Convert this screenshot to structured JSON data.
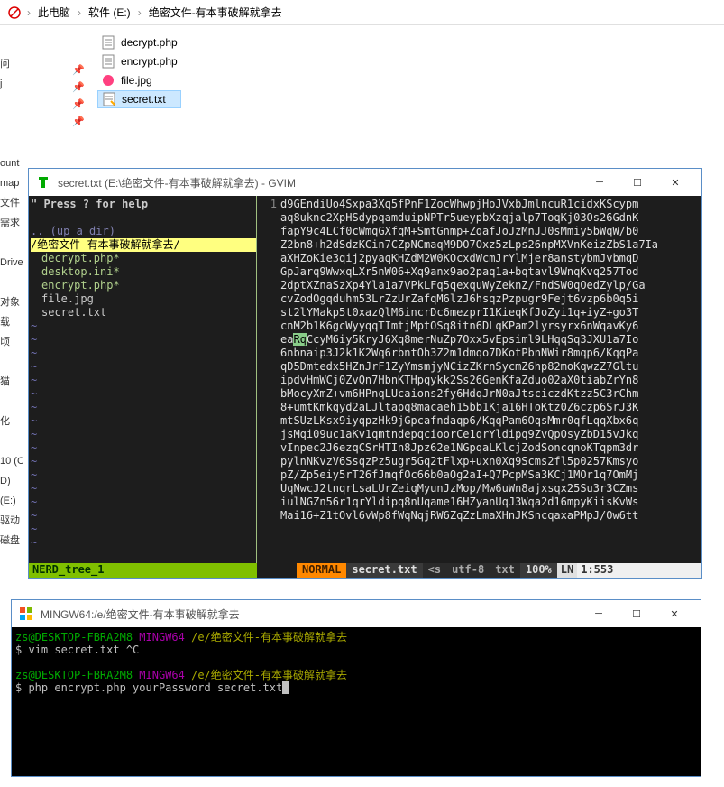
{
  "explorer": {
    "breadcrumb": {
      "root": "此电脑",
      "drive": "软件 (E:)",
      "folder": "绝密文件-有本事破解就拿去"
    },
    "files": [
      {
        "name": "decrypt.php",
        "icon": "php"
      },
      {
        "name": "encrypt.php",
        "icon": "php"
      },
      {
        "name": "file.jpg",
        "icon": "image"
      },
      {
        "name": "secret.txt",
        "icon": "text",
        "selected": true
      }
    ]
  },
  "left_fragments": [
    "问",
    "j",
    "",
    "",
    "",
    "ount",
    "map",
    "文件",
    "需求",
    "",
    "Drive",
    "",
    "对象",
    "载",
    "顷",
    "",
    "猫",
    "",
    "化",
    "",
    "10 (C",
    "D)",
    " (E:)",
    "驱动",
    "磁盘"
  ],
  "gvim": {
    "title": "secret.txt (E:\\绝密文件-有本事破解就拿去) - GVIM",
    "help": "\"  Press ? for help",
    "updir": ".. (up a dir)",
    "dir": "/绝密文件-有本事破解就拿去/",
    "tree_files": [
      "decrypt.php",
      "desktop.ini",
      "encrypt.php",
      "file.jpg",
      "secret.txt"
    ],
    "content_lines": [
      "d9GEndiUo4Sxpa3Xq5fPnF1ZocWhwpjHoJVxbJmlncuR1cidxKScypm",
      "aq8uknc2XpHSdypqamduipNPTr5ueypbXzqjalp7ToqKj03Os26GdnK",
      "fapY9c4LCf0cWmqGXfqM+SmtGnmp+ZqafJoJzMnJJ0sMmiy5bWqW/b0",
      "Z2bn8+h2dSdzKCin7CZpNCmaqM9DO7Oxz5zLps26npMXVnKeizZbS1a7Ia",
      "aXHZoKie3qij2pyaqKHZdM2W0KOcxdWcmJrYlMjer8anstybmJvbmqD",
      "GpJarq9WwxqLXr5nW06+Xq9anx9ao2paq1a+bqtavl9WnqKvq257Tod",
      "2dptXZnaSzXp4Yla1a7VPkLFq5qexquWyZeknZ/FndSW0qOedZylp/Ga",
      "cvZodOgqduhm53LrZzUrZafqM6lzJ6hsqzPzpugr9Fejt6vzp6b0q5i",
      "st2lYMakp5t0xazQlM6incrDc6mezprI1KieqKfJoZyi1q+iyZ+go3T",
      "cnM2b1K6gcWyyqqTImtjMptOSq8itn6DLqKPam2lyrsyrx6nWqavKy6",
      "ea  CcyM6iy5KryJ6Xq8merNuZp7Oxx5vEpsiml9LHqqSq3JXU1a7Io",
      "6nbnaip3J2k1K2Wq6rbntOh3Z2m1dmqo7DKotPbnNWir8mqp6/KqqPa",
      "qD5Dmtedx5HZnJrF1ZyYmsmjyNCizZKrnSycmZ6hp82moKqwzZ7Gltu",
      "ipdvHmWCj0ZvQn7HbnKTHpqykk2Ss26GenKfaZduo02aX0tiabZrYn8",
      "bMocyXmZ+vm6HPnqLUcaions2fy6HdqJrN0aJtsciczdKtzz5C3rChm",
      "8+umtKmkqyd2aLJltapq8macaeh15bb1Kja16HToKtz0Z6czp6SrJ3K",
      "mtSUzLKsx9iyqpzHk9jGpcafndaqp6/KqqPam6OqsMmr0qfLqqXbx6q",
      "jsMqi09uc1aKv1qmtndepqcioorCe1qrYldipq9ZvQpOsyZbD15vJkq",
      "vInpec2J6ezqCSrHTIn8Jpz62e1NGpqaLKlcjZodSoncqnoKTqpm3dr",
      "pylnNKvzV6SsqzPz5ugr5Gq2tFlxp+uxn0Xq9Scms2fl5p0257Kmsyo",
      "pZ/Zp5eiy5rT26fJmqfOc66b0aOg2aI+Q7PcpMSa3KCj1MOr1q7OmMj",
      "UqNwcJ2tnqrLsaLUrZeiqMyunJzMop/Mw6uWn8ajxsqx25Su3r3CZms",
      "iulNGZn56r1qrYldipq8nUqame16HZyanUqJ3Wqa2d16mpyKiisKvWs",
      "Mai16+Z1tOvl6vWp8fWqNqjRW6ZqZzLmaXHnJKSncqaxaPMpJ/Ow6tt"
    ],
    "highlight_line_index": 10,
    "highlight_chars": "Rq",
    "status": {
      "nerd": "NERD_tree_1",
      "mode": "NORMAL",
      "file": "secret.txt",
      "seg1": "<s",
      "seg2": "utf-8",
      "seg3": "txt",
      "pct": "100%",
      "ln_label": "LN",
      "pos": "1:553"
    }
  },
  "mingw": {
    "title": "MINGW64:/e/绝密文件-有本事破解就拿去",
    "lines": [
      {
        "user": "zs@DESKTOP-FBRA2M8",
        "host": "MINGW64",
        "path": "/e/绝密文件-有本事破解就拿去"
      },
      {
        "cmd": "$ vim secret.txt ^C"
      },
      {
        "blank": true
      },
      {
        "user": "zs@DESKTOP-FBRA2M8",
        "host": "MINGW64",
        "path": "/e/绝密文件-有本事破解就拿去"
      },
      {
        "cmd": "$ php encrypt.php yourPassword secret.txt",
        "cursor": true
      }
    ]
  }
}
